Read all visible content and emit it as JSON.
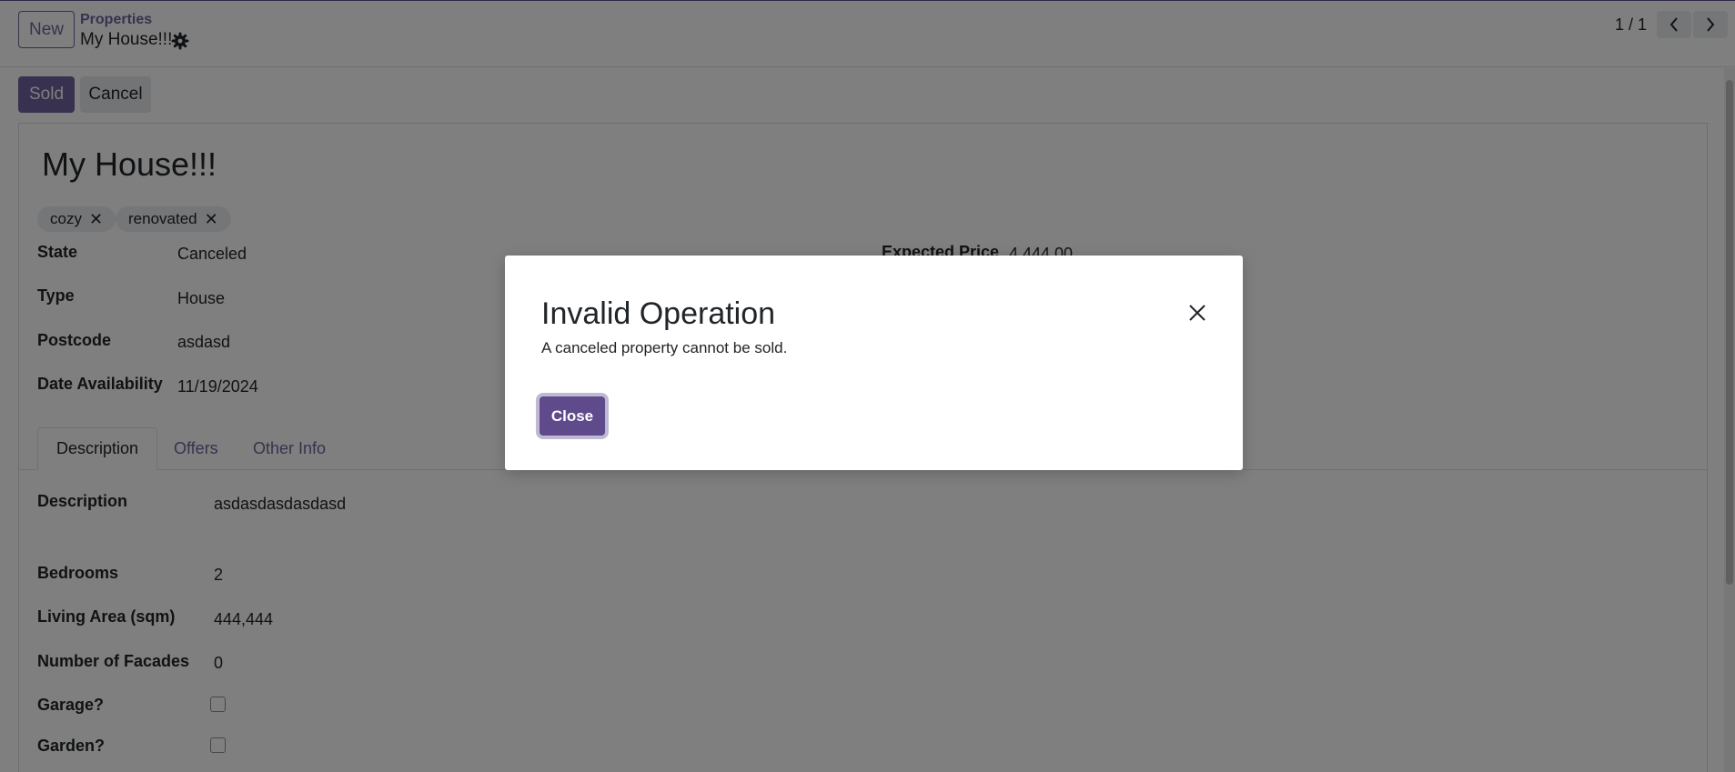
{
  "breadcrumb": {
    "new_label": "New",
    "parent": "Properties",
    "current": "My House!!!"
  },
  "pager": {
    "value": "1 / 1"
  },
  "statusbar": {
    "sold_label": "Sold",
    "cancel_label": "Cancel"
  },
  "form": {
    "title": "My House!!!",
    "tags": [
      "cozy",
      "renovated"
    ],
    "fields_left": [
      {
        "label": "State",
        "value": "Canceled"
      },
      {
        "label": "Type",
        "value": "House"
      },
      {
        "label": "Postcode",
        "value": "asdasd"
      },
      {
        "label": "Date Availability",
        "value": "11/19/2024"
      }
    ],
    "fields_right": [
      {
        "label": "Expected Price",
        "value": "4,444.00"
      }
    ],
    "tabs": [
      "Description",
      "Offers",
      "Other Info"
    ],
    "active_tab": "Description",
    "description": [
      {
        "label": "Description",
        "value": "asdasdasdasdasd"
      },
      {
        "label": "Bedrooms",
        "value": "2"
      },
      {
        "label": "Living Area (sqm)",
        "value": "444,444"
      },
      {
        "label": "Number of Facades",
        "value": "0"
      },
      {
        "label": "Garage?",
        "value": ""
      },
      {
        "label": "Garden?",
        "value": ""
      }
    ]
  },
  "dialog": {
    "title": "Invalid Operation",
    "message": "A canceled property cannot be sold.",
    "close_label": "Close"
  },
  "colors": {
    "primary": "#71639e",
    "primary_dark": "#5f4b8b",
    "backdrop": "rgba(0,0,0,0.5)"
  },
  "icons": [
    "gear-icon",
    "chevron-left-icon",
    "chevron-right-icon",
    "close-icon",
    "tag-remove-icon"
  ]
}
